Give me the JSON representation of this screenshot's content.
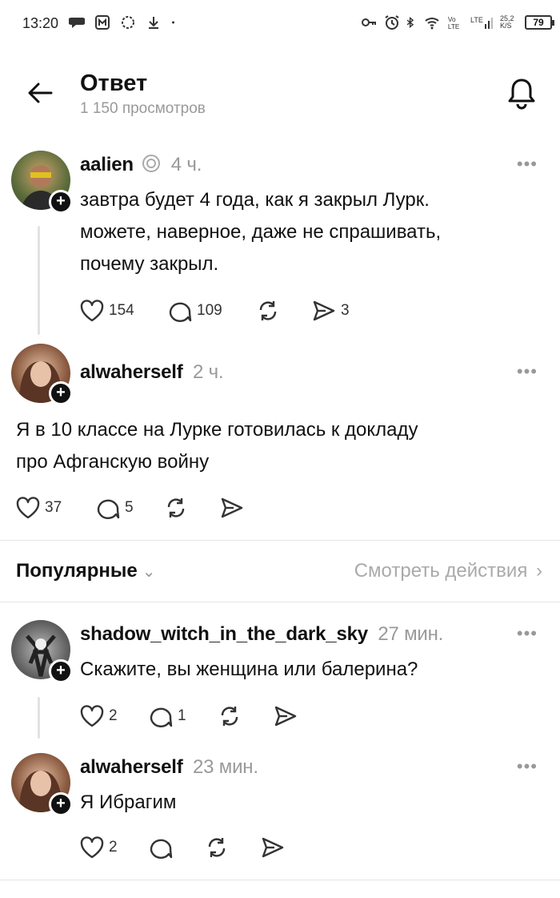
{
  "status_bar": {
    "time": "13:20",
    "battery": "79",
    "net_speed": "25,2 K/S",
    "left_icons": [
      "chat-bubble-icon",
      "m-app-icon",
      "brain-icon",
      "download-icon",
      "dot-icon"
    ],
    "right_icons": [
      "key-icon",
      "alarm-icon",
      "bluetooth-icon",
      "wifi-icon",
      "volte-icon",
      "lte-signal-icon"
    ]
  },
  "header": {
    "title": "Ответ",
    "subtitle": "1 150 просмотров",
    "back_icon": "arrow-left-icon",
    "bell_icon": "bell-icon"
  },
  "posts": [
    {
      "username": "aalien",
      "time": "4 ч.",
      "text_lines": [
        "завтра будет 4 года, как я закрыл Лурк.",
        "можете, наверное, даже не спрашивать,",
        "почему закрыл."
      ],
      "likes": "154",
      "replies": "109",
      "reposts": "",
      "shares": "3"
    },
    {
      "username": "alwaherself",
      "time": "2 ч.",
      "text_lines": [
        "Я в 10 классе на Лурке готовилась к докладу",
        "про Афганскую войну"
      ],
      "likes": "37",
      "replies": "5",
      "reposts": "",
      "shares": ""
    },
    {
      "username": "shadow_witch_in_the_dark_sky",
      "time": "27 мин.",
      "text_lines": [
        "Скажите, вы женщина или балерина?"
      ],
      "likes": "2",
      "replies": "1",
      "reposts": "",
      "shares": ""
    },
    {
      "username": "alwaherself",
      "time": "23 мин.",
      "text_lines": [
        "Я Ибрагим"
      ],
      "likes": "2",
      "replies": "",
      "reposts": "",
      "shares": ""
    }
  ],
  "popular": {
    "label": "Популярные",
    "view_actions": "Смотреть действия"
  },
  "colors": {
    "text": "#111111",
    "muted": "#999999",
    "divider": "#e4e4e4"
  }
}
